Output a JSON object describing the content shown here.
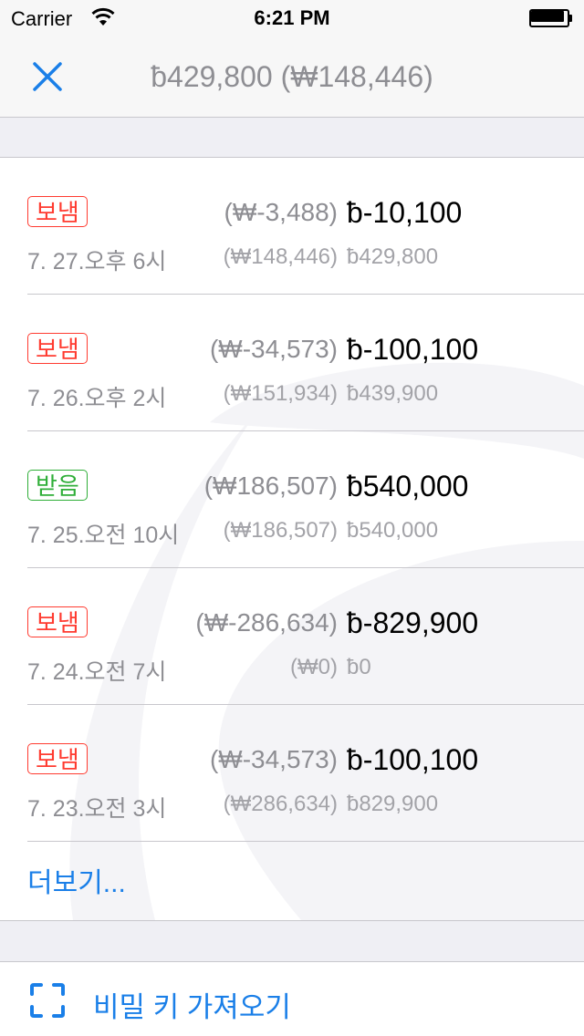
{
  "status_bar": {
    "carrier": "Carrier",
    "time": "6:21 PM",
    "wifi_icon": "wifi-icon",
    "battery_icon": "battery-full-icon"
  },
  "nav": {
    "close_icon": "close-icon",
    "title": "ƀ429,800 (₩148,446)"
  },
  "colors": {
    "sent": "#ff3b30",
    "received": "#2fae38",
    "link": "#1a7fe8",
    "secondary_text": "#8e8e93",
    "group_background": "#efeff4"
  },
  "transactions": [
    {
      "type": "보냄",
      "kind": "sent",
      "krw_amount": "(₩-3,488)",
      "btc_amount": "ƀ-10,100",
      "date": "7. 27.오후 6시",
      "krw_balance": "(₩148,446)",
      "btc_balance": "ƀ429,800"
    },
    {
      "type": "보냄",
      "kind": "sent",
      "krw_amount": "(₩-34,573)",
      "btc_amount": "ƀ-100,100",
      "date": "7. 26.오후 2시",
      "krw_balance": "(₩151,934)",
      "btc_balance": "ƀ439,900"
    },
    {
      "type": "받음",
      "kind": "received",
      "krw_amount": "(₩186,507)",
      "btc_amount": "ƀ540,000",
      "date": "7. 25.오전 10시",
      "krw_balance": "(₩186,507)",
      "btc_balance": "ƀ540,000"
    },
    {
      "type": "보냄",
      "kind": "sent",
      "krw_amount": "(₩-286,634)",
      "btc_amount": "ƀ-829,900",
      "date": "7. 24.오전 7시",
      "krw_balance": "(₩0)",
      "btc_balance": "ƀ0"
    },
    {
      "type": "보냄",
      "kind": "sent",
      "krw_amount": "(₩-34,573)",
      "btc_amount": "ƀ-100,100",
      "date": "7. 23.오전 3시",
      "krw_balance": "(₩286,634)",
      "btc_balance": "ƀ829,900"
    }
  ],
  "more_label": "더보기...",
  "import": {
    "icon": "scan-qr-icon",
    "label": "비밀 키 가져오기"
  }
}
